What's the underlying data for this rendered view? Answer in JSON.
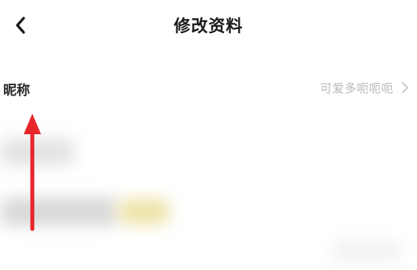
{
  "header": {
    "title": "修改资料",
    "back_icon": "chevron-left-icon"
  },
  "nickname_row": {
    "label": "昵称",
    "value": "可爱多呃呃呃",
    "chevron_icon": "chevron-right-icon"
  },
  "annotation": {
    "arrow_color": "#e8252b"
  }
}
